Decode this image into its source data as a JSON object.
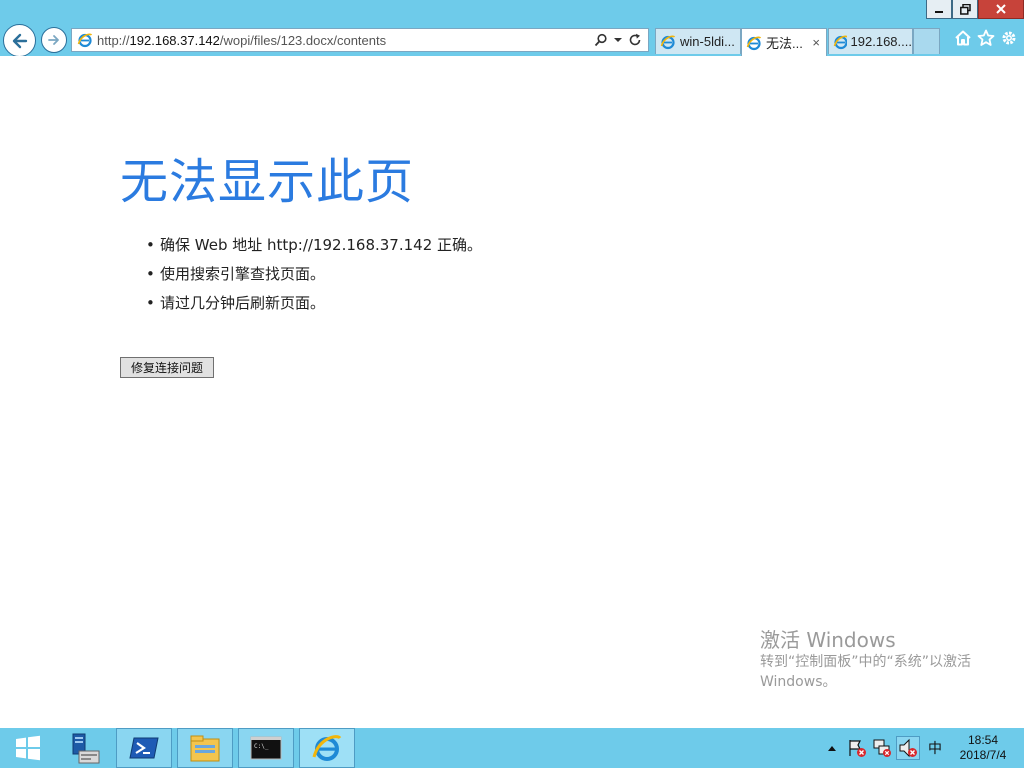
{
  "browser": {
    "address": {
      "scheme": "http://",
      "host": "192.168.37.142",
      "path": "/wopi/files/123.docx/contents"
    },
    "tabs": [
      {
        "label": "win-5ldi...",
        "active": false
      },
      {
        "label": "无法...",
        "active": true,
        "close": "×"
      },
      {
        "label": "192.168....",
        "active": false
      }
    ],
    "icons": {
      "back": "back-arrow-icon",
      "forward": "forward-arrow-icon",
      "search": "search-icon",
      "dropdown": "dropdown-icon",
      "refresh": "refresh-icon",
      "home": "home-icon",
      "favorites": "star-icon",
      "tools": "gear-icon"
    }
  },
  "page": {
    "title": "无法显示此页",
    "tips": [
      "确保 Web 地址 http://192.168.37.142 正确。",
      "使用搜索引擎查找页面。",
      "请过几分钟后刷新页面。"
    ],
    "fix_button": "修复连接问题"
  },
  "watermark": {
    "title": "激活 Windows",
    "line1": "转到“控制面板”中的“系统”以激活",
    "line2": "Windows。"
  },
  "taskbar": {
    "items": [
      "start-icon",
      "server-manager-icon",
      "powershell-icon",
      "file-explorer-icon",
      "command-prompt-icon",
      "internet-explorer-icon"
    ],
    "ime": "中",
    "time": "18:54",
    "date": "2018/7/4"
  },
  "colors": {
    "chrome": "#6ecbea",
    "heading": "#2b7be0",
    "watermark": "#9a9a9a"
  }
}
